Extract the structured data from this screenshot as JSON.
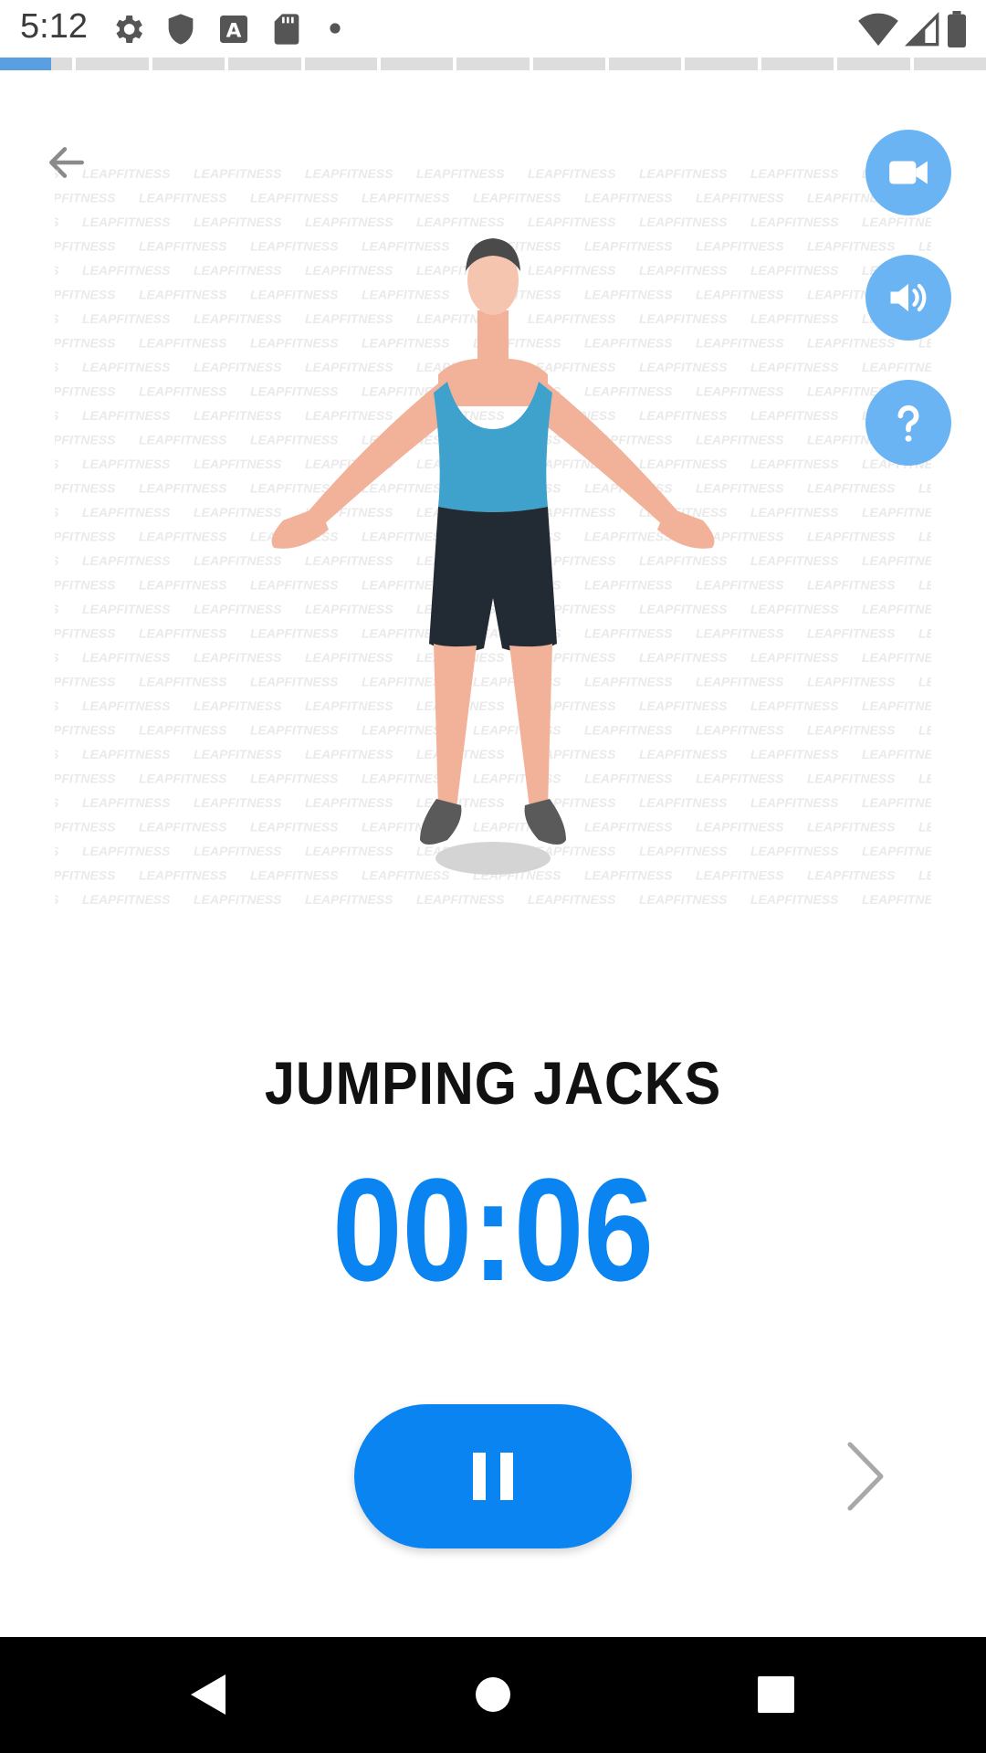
{
  "status_bar": {
    "time": "5:12",
    "icons": [
      "gear-icon",
      "shield-icon",
      "a-box-icon",
      "sd-card-icon",
      "dot-icon",
      "wifi-icon",
      "signal-icon",
      "battery-icon"
    ]
  },
  "progress": {
    "total_segments": 13,
    "completed_segments": 1,
    "completed_fraction": 0.7
  },
  "exercise": {
    "name": "JUMPING JACKS",
    "timer": "00:06",
    "watermark_text": "LEAPFITNESS"
  },
  "controls": {
    "back_icon": "arrow-left-icon",
    "video_icon": "video-camera-icon",
    "sound_icon": "speaker-icon",
    "help_icon": "question-icon",
    "pause_icon": "pause-icon",
    "next_icon": "chevron-right-icon"
  },
  "colors": {
    "accent": "#0a84f0",
    "fab": "#6ab4f4",
    "progress_done": "#5b9fe3",
    "progress_todo": "#dddddd"
  }
}
